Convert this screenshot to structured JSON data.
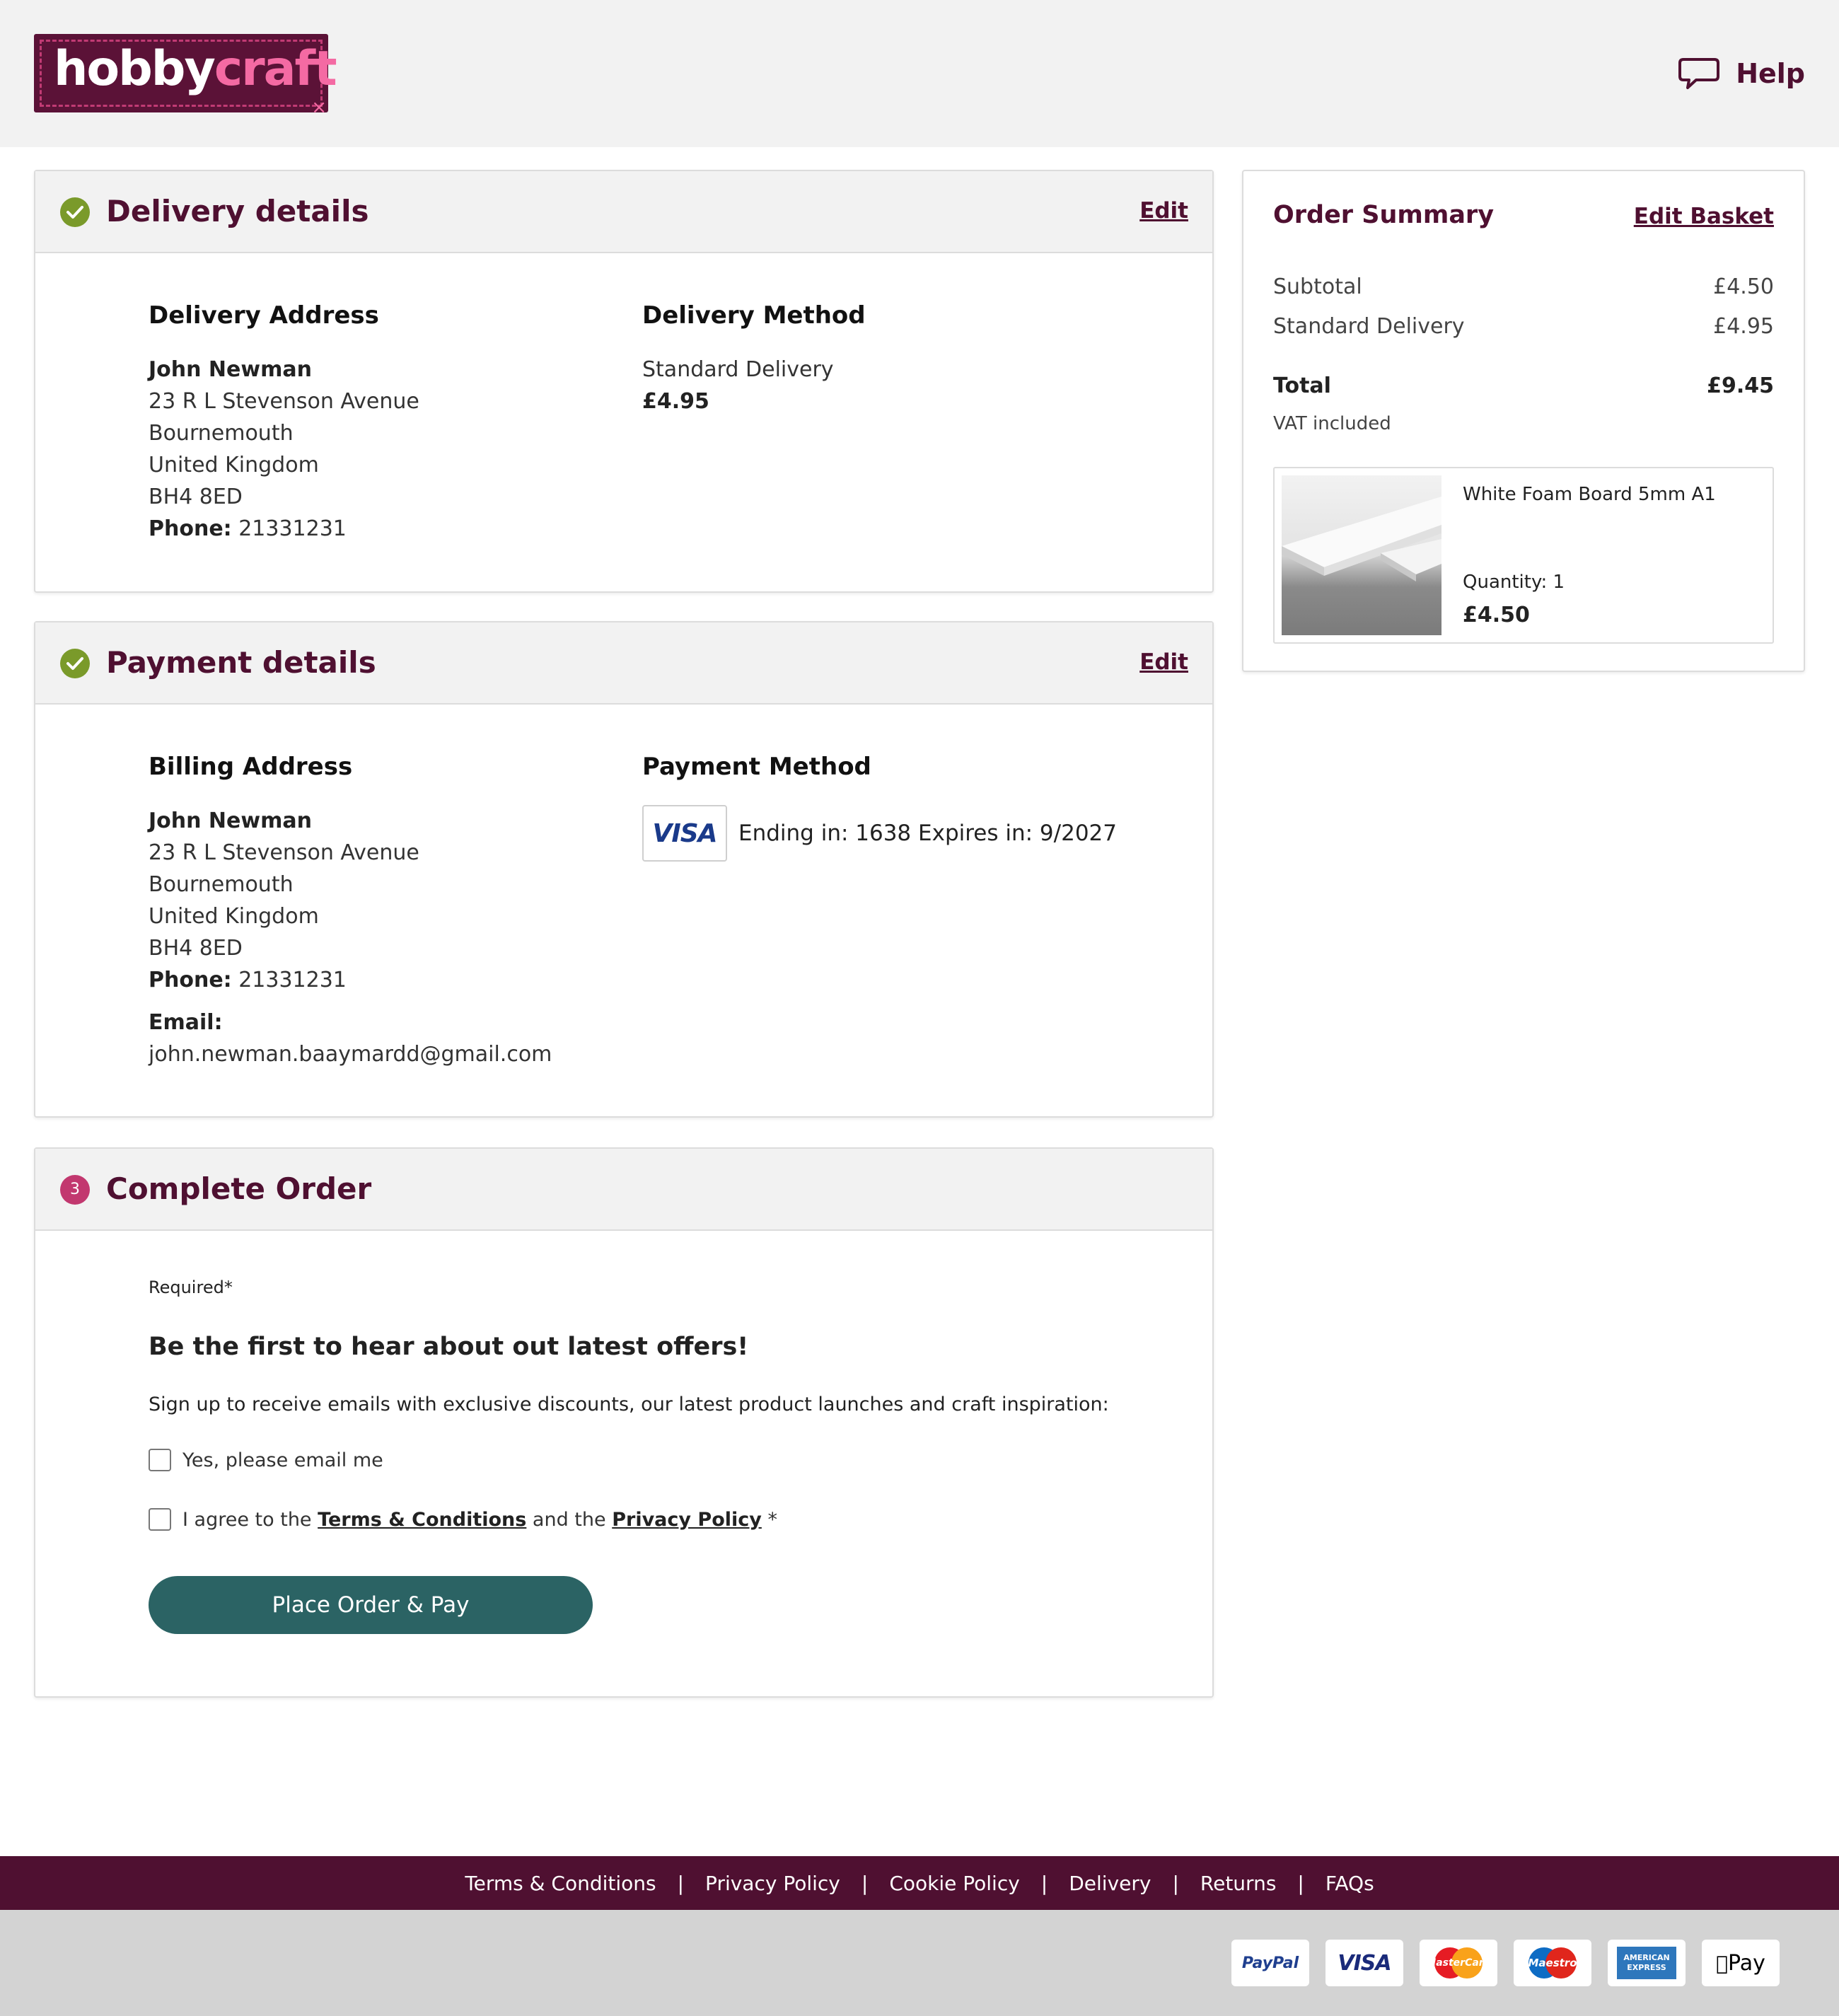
{
  "header": {
    "logo": {
      "brand_part1": "hobby",
      "brand_part2": "craft"
    },
    "help_label": "Help"
  },
  "delivery": {
    "title": "Delivery details",
    "edit_label": "Edit",
    "address_heading": "Delivery Address",
    "name": "John Newman",
    "line1": "23 R L Stevenson Avenue",
    "city": "Bournemouth",
    "country": "United Kingdom",
    "postcode": "BH4 8ED",
    "phone_label": "Phone:",
    "phone": "21331231",
    "method_heading": "Delivery Method",
    "method_name": "Standard Delivery",
    "method_price": "£4.95"
  },
  "payment": {
    "title": "Payment details",
    "edit_label": "Edit",
    "billing_heading": "Billing Address",
    "name": "John Newman",
    "line1": "23 R L Stevenson Avenue",
    "city": "Bournemouth",
    "country": "United Kingdom",
    "postcode": "BH4 8ED",
    "phone_label": "Phone:",
    "phone": "21331231",
    "email_label": "Email:",
    "email": "john.newman.baaymardd@gmail.com",
    "method_heading": "Payment Method",
    "card_brand": "VISA",
    "card_info": "Ending in: 1638 Expires in: 9/2027"
  },
  "complete": {
    "step_number": "3",
    "title": "Complete Order",
    "required_note": "Required*",
    "offers_heading": "Be the first to hear about out latest offers!",
    "signup_text": "Sign up to receive emails with exclusive discounts, our latest product launches and craft inspiration:",
    "email_optin_label": "Yes, please email me",
    "agree_prefix": "I agree to the",
    "terms_link": "Terms & Conditions",
    "agree_middle": "and the",
    "privacy_link": "Privacy Policy",
    "agree_suffix": "*",
    "place_order_label": "Place Order & Pay"
  },
  "summary": {
    "title": "Order Summary",
    "edit_basket_label": "Edit Basket",
    "subtotal_label": "Subtotal",
    "subtotal_value": "£4.50",
    "delivery_label": "Standard Delivery",
    "delivery_value": "£4.95",
    "total_label": "Total",
    "total_value": "£9.45",
    "vat_note": "VAT included",
    "item": {
      "name": "White Foam Board 5mm A1",
      "quantity_label": "Quantity: 1",
      "price": "£4.50"
    }
  },
  "footer": {
    "links": [
      "Terms & Conditions",
      "Privacy Policy",
      "Cookie Policy",
      "Delivery",
      "Returns",
      "FAQs"
    ],
    "payment_methods": {
      "paypal": "PayPal",
      "visa": "VISA",
      "mastercard": "MasterCard",
      "maestro": "Maestro",
      "amex_line1": "AMERICAN",
      "amex_line2": "EXPRESS",
      "applepay": "Pay"
    }
  },
  "colors": {
    "brand": "#4f1031",
    "check_green": "#7a9a2a",
    "step_pink": "#c2386f",
    "button_teal": "#2b6364"
  }
}
